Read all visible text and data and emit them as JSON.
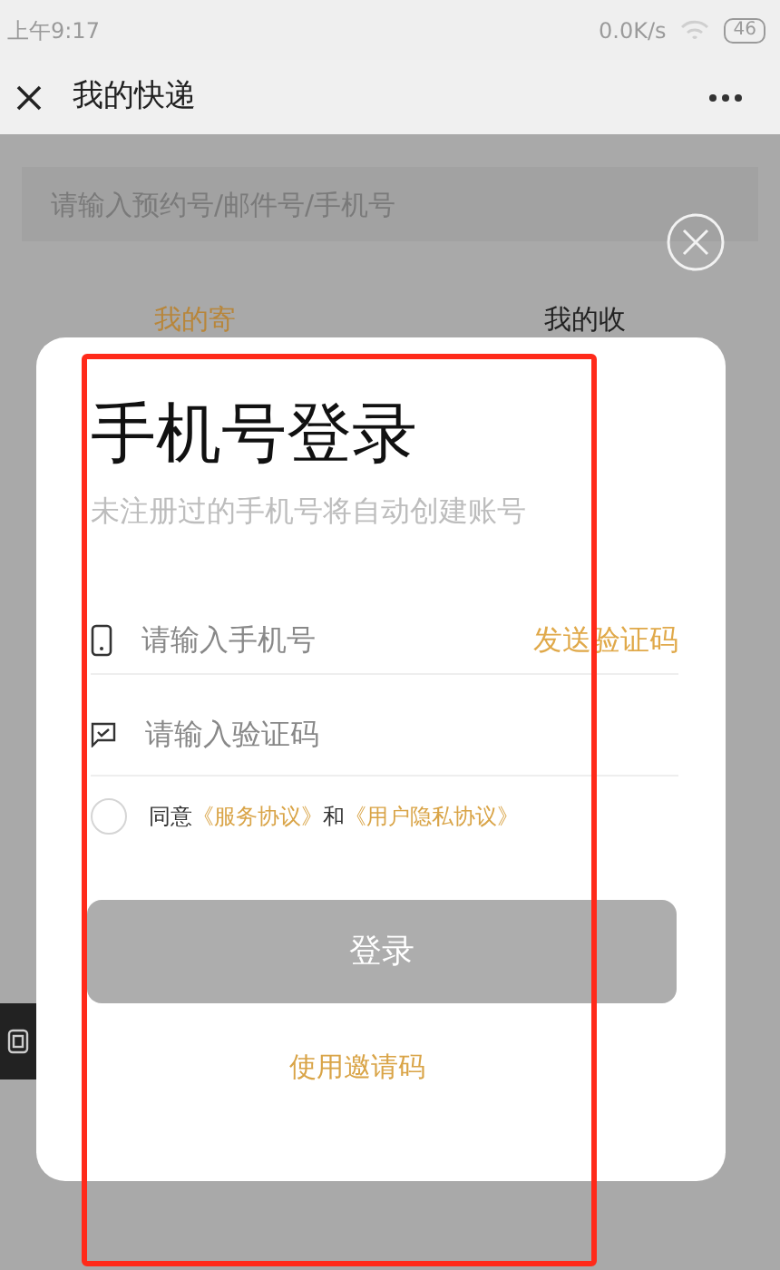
{
  "status_bar": {
    "time": "上午9:17",
    "net_speed": "0.0K/s",
    "battery": "46"
  },
  "header": {
    "title": "我的快递"
  },
  "search": {
    "placeholder": "请输入预约号/邮件号/手机号"
  },
  "tabs": [
    {
      "label": "我的寄",
      "selected": true
    },
    {
      "label": "我的收",
      "selected": false
    }
  ],
  "login_dialog": {
    "title": "手机号登录",
    "subtitle": "未注册过的手机号将自动创建账号",
    "phone_field": {
      "placeholder": "请输入手机号"
    },
    "send_code": "发送验证码",
    "code_field": {
      "placeholder": "请输入验证码"
    },
    "agreement": {
      "checked": false,
      "prefix": "同意",
      "link_1": "《服务协议》",
      "joiner": "和",
      "link_2": "《用户隐私协议》"
    },
    "login_button": {
      "label": "登录",
      "disabled": true
    },
    "invite_link": "使用邀请码"
  }
}
